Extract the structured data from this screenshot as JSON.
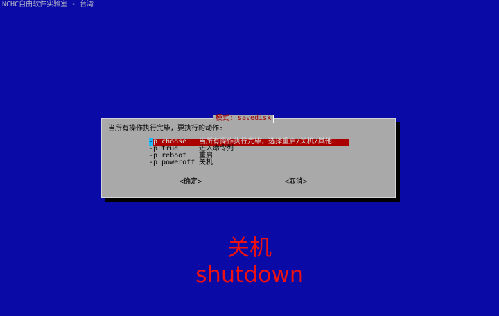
{
  "window": {
    "title": "NCHC自由软件实验室 - 台湾"
  },
  "dialog": {
    "title": "模式: savedisk",
    "prompt": "当所有操作执行完毕，要执行的动作:",
    "items": [
      {
        "tag_cursor": "-",
        "tag_rest": "p choose",
        "description": "当所有操作执行完毕，选择重启/关机/其他",
        "selected": true
      },
      {
        "tag": "-p true",
        "description": "进入命令列"
      },
      {
        "tag": "-p reboot",
        "description": "重启"
      },
      {
        "tag": "-p poweroff",
        "description": "关机"
      }
    ],
    "ok_button": "<确定>",
    "cancel_button": "<取消>"
  },
  "overlay": {
    "chinese": "关机",
    "english": "shutdown"
  },
  "colors": {
    "background": "#0a0aa6",
    "dialog": "#a9a9a9",
    "highlight": "#aa0000",
    "cursor": "#22b8ff",
    "overlay_text": "#ee1111"
  }
}
